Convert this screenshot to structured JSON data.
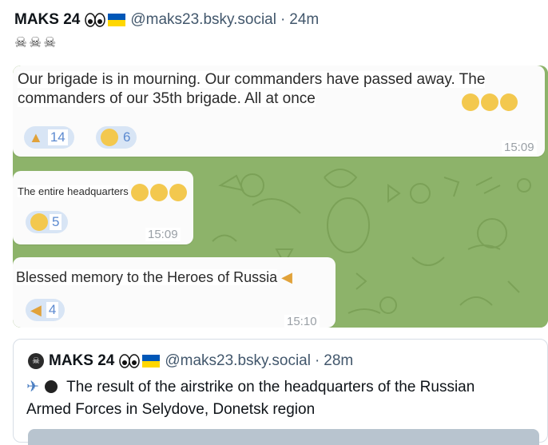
{
  "post": {
    "author": "MAKS 24",
    "handle": "@maks23.bsky.social",
    "time": "24m",
    "skulls_icon": "skull-crossbones-icon x3"
  },
  "screenshot": {
    "messages": [
      {
        "line1": "Our brigade is in mourning. Our commanders have passed away. The",
        "line2": "commanders of our 35th brigade. All at once",
        "reactions": [
          {
            "icon": "folded-hands-icon",
            "count": "14"
          },
          {
            "icon": "crying-face-icon",
            "count": "6"
          }
        ],
        "time": "15:09"
      },
      {
        "text": "The entire headquarters",
        "reactions": [
          {
            "icon": "sad-face-icon",
            "count": "5"
          }
        ],
        "time": "15:09"
      },
      {
        "text": "Blessed memory to the Heroes of Russia",
        "reactions": [
          {
            "icon": "pointing-hand-icon",
            "count": "4"
          }
        ],
        "time": "15:10"
      }
    ]
  },
  "quote": {
    "author": "MAKS 24",
    "handle": "@maks23.bsky.social",
    "time": "28m",
    "text": "The result of the airstrike on the headquarters of the Russian Armed Forces in Selydove, Donetsk region"
  },
  "colors": {
    "brand_blue": "#0057b7",
    "flag_yellow": "#ffd700",
    "chat_green": "#8fb06a",
    "reaction_blue": "#5c8ad0"
  }
}
